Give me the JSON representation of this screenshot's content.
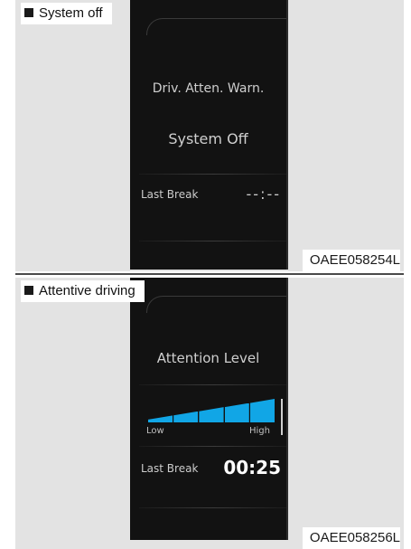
{
  "panels": [
    {
      "caption": "System off",
      "display": {
        "title": "Driv. Atten. Warn.",
        "status": "System Off",
        "last_break_label": "Last Break",
        "last_break_value": "--:--"
      },
      "code": "OAEE058254L"
    },
    {
      "caption": "Attentive driving",
      "display": {
        "title": "Attention Level",
        "gauge_low_label": "Low",
        "gauge_high_label": "High",
        "gauge_level_segments": 5,
        "gauge_total_segments": 5,
        "gauge_color": "#11a6e6",
        "last_break_label": "Last Break",
        "last_break_value": "00:25"
      },
      "code": "OAEE058256L"
    }
  ]
}
